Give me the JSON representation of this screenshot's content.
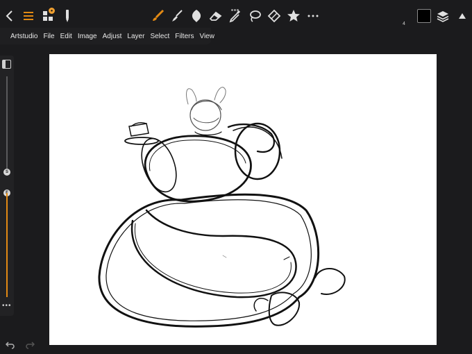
{
  "toolbar": {
    "tools": [
      "back-icon",
      "menu-icon",
      "gallery-icon",
      "pencil-settings-icon",
      "brush-icon",
      "smudge-icon",
      "blur-icon",
      "eraser-icon",
      "eyedropper-icon",
      "lasso-icon",
      "transform-icon",
      "star-icon",
      "more-icon"
    ],
    "layer_count": "4",
    "current_color": "#000000",
    "accent": "#e38a14"
  },
  "menu": {
    "items": [
      "Artstudio",
      "File",
      "Edit",
      "Image",
      "Adjust",
      "Layer",
      "Select",
      "Filters",
      "View"
    ]
  },
  "sidebar": {
    "size_knob": "S",
    "flow_knob": "F"
  }
}
